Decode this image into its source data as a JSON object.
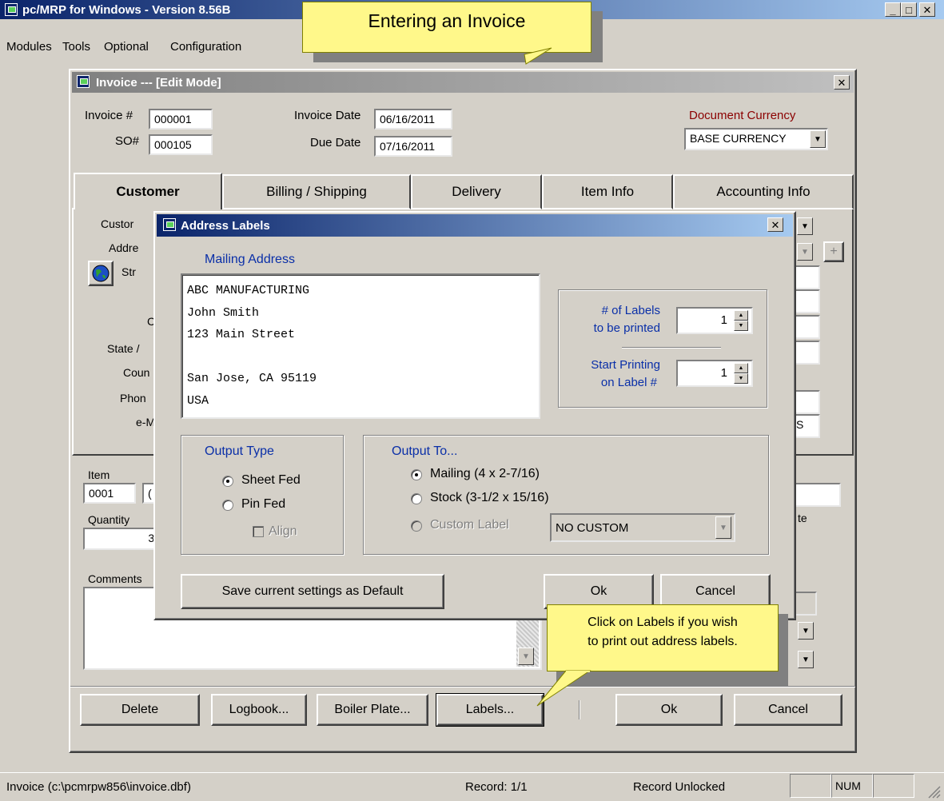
{
  "app": {
    "title": "pc/MRP for Windows - Version 8.56B",
    "menu": [
      "Modules",
      "Tools",
      "Optional",
      "Configuration"
    ]
  },
  "callout_top": {
    "text": "Entering an Invoice"
  },
  "invoice": {
    "title": "Invoice --- [Edit Mode]",
    "invoice_no_label": "Invoice #",
    "invoice_no": "000001",
    "so_label": "SO#",
    "so_no": "000105",
    "invoice_date_label": "Invoice Date",
    "invoice_date": "06/16/2011",
    "due_date_label": "Due Date",
    "due_date": "07/16/2011",
    "currency_label": "Document Currency",
    "currency_value": "BASE CURRENCY",
    "tabs": [
      "Customer",
      "Billing / Shipping",
      "Delivery",
      "Item Info",
      "Accounting Info"
    ],
    "left_labels": [
      "Custor",
      "Addre",
      "Str",
      "C",
      "State /",
      "Coun",
      "Phon",
      "e-M"
    ],
    "right_fragment": "S",
    "item_label": "Item",
    "item_value": "0001",
    "item_value2": "(",
    "quantity_label": "Quantity",
    "quantity_value": "3.",
    "right_te": "te",
    "comments_label": "Comments",
    "buttons": {
      "delete": "Delete",
      "logbook": "Logbook...",
      "boiler": "Boiler Plate...",
      "labels": "Labels...",
      "ok": "Ok",
      "cancel": "Cancel"
    }
  },
  "address_dialog": {
    "title": "Address Labels",
    "mailing_address_label": "Mailing Address",
    "address_lines": [
      "ABC MANUFACTURING",
      "John Smith",
      "123 Main Street",
      "",
      "San Jose, CA 95119",
      "USA"
    ],
    "num_labels_label_1": "# of Labels",
    "num_labels_label_2": "to be printed",
    "num_labels_value": "1",
    "start_label_1": "Start Printing",
    "start_label_2": "on Label #",
    "start_value": "1",
    "output_type_label": "Output Type",
    "sheet_fed": "Sheet Fed",
    "pin_fed": "Pin Fed",
    "align": "Align",
    "output_to_label": "Output To...",
    "mailing": "Mailing (4 x 2-7/16)",
    "stock": "Stock (3-1/2 x 15/16)",
    "custom_label": "Custom Label",
    "custom_value": "NO CUSTOM",
    "save_default": "Save current settings as Default",
    "ok": "Ok",
    "cancel": "Cancel"
  },
  "callout_bottom": {
    "line1": "Click on Labels if you wish",
    "line2": "to print out address labels."
  },
  "status": {
    "file": "Invoice (c:\\pcmrpw856\\invoice.dbf)",
    "record": "Record: 1/1",
    "lock": "Record Unlocked",
    "num": "NUM"
  }
}
